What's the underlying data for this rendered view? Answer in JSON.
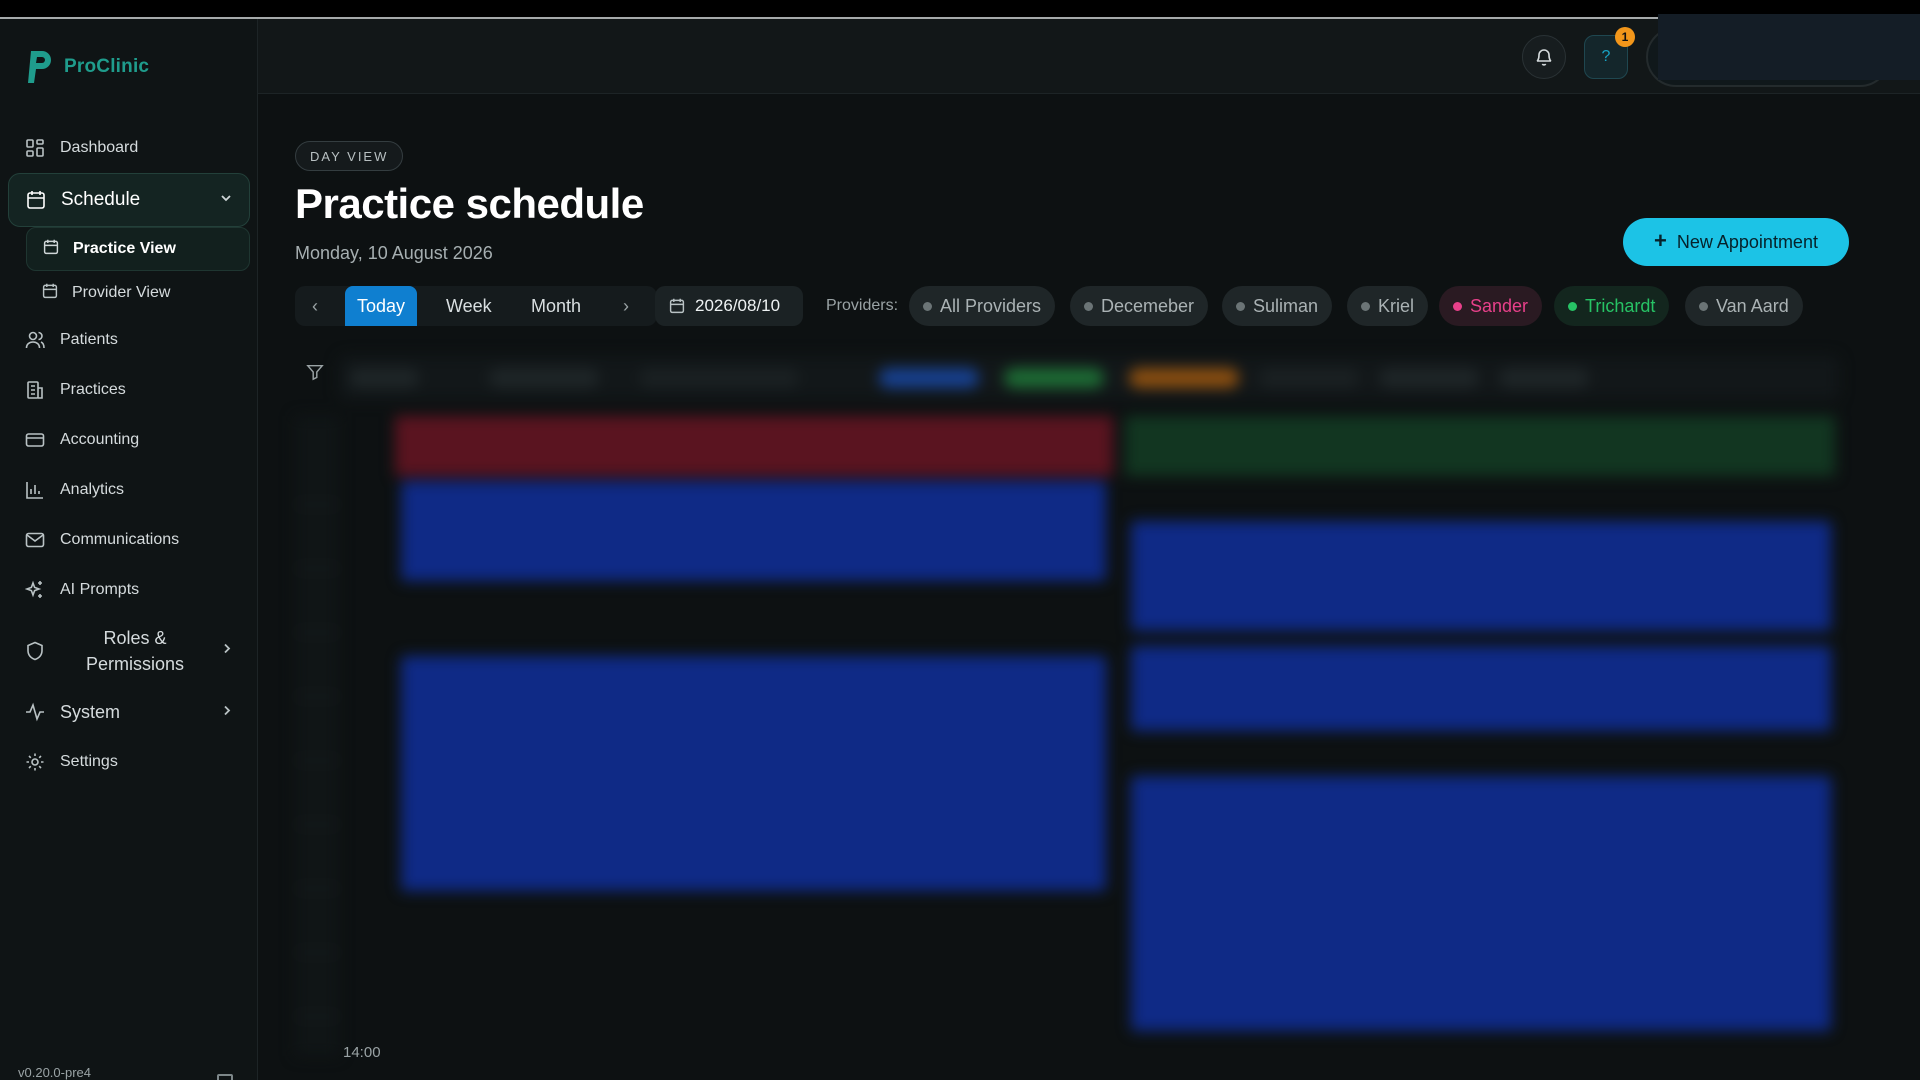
{
  "app": {
    "name": "ProClinic",
    "version": "v0.20.0-pre4"
  },
  "sidebar": {
    "items": [
      {
        "label": "Dashboard",
        "icon": "grid-icon"
      },
      {
        "label": "Schedule",
        "icon": "calendar-icon",
        "active": true,
        "expanded": true,
        "children": [
          {
            "label": "Practice View",
            "icon": "calendar-icon",
            "active": true
          },
          {
            "label": "Provider View",
            "icon": "calendar-icon"
          }
        ]
      },
      {
        "label": "Patients",
        "icon": "users-icon"
      },
      {
        "label": "Practices",
        "icon": "building-icon"
      },
      {
        "label": "Accounting",
        "icon": "card-icon"
      },
      {
        "label": "Analytics",
        "icon": "bar-chart-icon"
      },
      {
        "label": "Communications",
        "icon": "mail-icon"
      },
      {
        "label": "AI Prompts",
        "icon": "sparkles-icon"
      },
      {
        "label": "Roles & Permissions",
        "icon": "shield-icon"
      },
      {
        "label": "System",
        "icon": "activity-icon"
      },
      {
        "label": "Settings",
        "icon": "gear-icon"
      }
    ]
  },
  "header": {
    "notifications_icon": "bell-icon",
    "help_icon": "question-icon",
    "help_badge": "1"
  },
  "main": {
    "view_chip": "DAY VIEW",
    "title": "Practice schedule",
    "date": "Monday, 10 August 2026",
    "new_appointment_label": "New Appointment"
  },
  "toolbar": {
    "views": [
      "Today",
      "Week",
      "Month"
    ],
    "active_view": "Today",
    "date_value": "2026/08/10",
    "providers_label": "Providers:",
    "providers": [
      {
        "name": "All Providers",
        "color": "#6b7476"
      },
      {
        "name": "Decemeber",
        "color": "#6b7476"
      },
      {
        "name": "Suliman",
        "color": "#6b7476"
      },
      {
        "name": "Kriel",
        "color": "#6b7476"
      },
      {
        "name": "Sander",
        "color": "#e8408a"
      },
      {
        "name": "Trichardt",
        "color": "#27c265"
      },
      {
        "name": "Van Aard",
        "color": "#6b7476"
      }
    ]
  },
  "calendar": {
    "visible_time": "14:00"
  },
  "colors": {
    "accent": "#1cc3e6",
    "brand": "#1f9c8c",
    "active_tab": "#0f7fd0",
    "appointment": "#0f2a86"
  }
}
